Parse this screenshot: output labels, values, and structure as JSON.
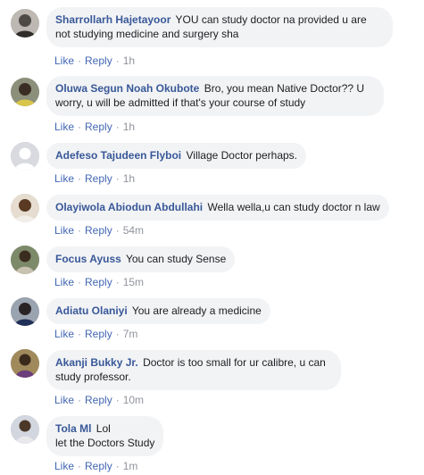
{
  "actions": {
    "like": "Like",
    "reply": "Reply",
    "separator": "·"
  },
  "comments": [
    {
      "author": "Sharrollarh Hajetayoor",
      "text": "YOU can study doctor na provided u are not studying medicine and surgery sha",
      "time": "1h",
      "avatar_color": "#6d6a66"
    },
    {
      "author": "Oluwa Segun Noah Okubote",
      "text": "Bro, you mean Native Doctor?? U worry, u will be admitted if that's your course of study",
      "time": "1h",
      "avatar_color": "#4a4f3a"
    },
    {
      "author": "Adefeso Tajudeen Flyboi",
      "text": "Village Doctor perhaps.",
      "time": "1h",
      "avatar_color": "#c9ccd1"
    },
    {
      "author": "Olayiwola Abiodun Abdullahi",
      "text": "Wella wella,u can study doctor n law",
      "time": "54m",
      "avatar_color": "#b99a7a"
    },
    {
      "author": "Focus Ayuss",
      "text": "You can study Sense",
      "time": "15m",
      "avatar_color": "#5b6b4a"
    },
    {
      "author": "Adiatu Olaniyi",
      "text": "You are already a medicine",
      "time": "7m",
      "avatar_color": "#3d3a44"
    },
    {
      "author": "Akanji Bukky Jr.",
      "text": "Doctor is too small for ur calibre, u can study professor.",
      "time": "10m",
      "avatar_color": "#6a5a3e"
    },
    {
      "author": "Tola Ml",
      "text": "Lol let the Doctors Study",
      "text_lines": [
        "Lol",
        "let the Doctors Study"
      ],
      "time": "1m",
      "avatar_color": "#8a8f99"
    }
  ]
}
